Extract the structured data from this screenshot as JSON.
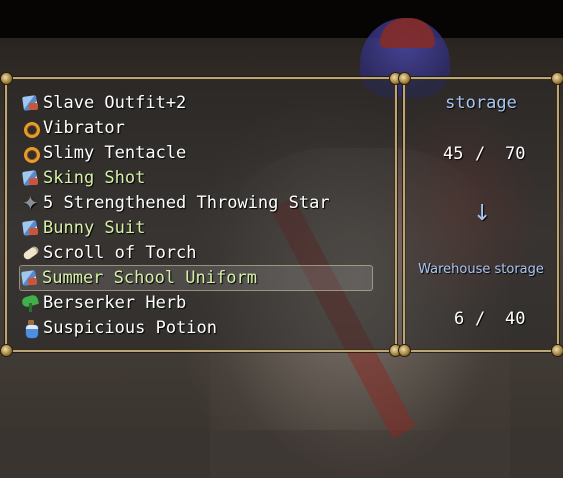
{
  "items": [
    {
      "icon": "outfit-icon",
      "label": "Slave Outfit+2",
      "color": "#ffffff"
    },
    {
      "icon": "ring-icon",
      "label": "Vibrator",
      "color": "#ffffff"
    },
    {
      "icon": "ring-icon",
      "label": "Slimy Tentacle",
      "color": "#ffffff"
    },
    {
      "icon": "outfit-icon",
      "label": "Sking Shot",
      "color": "#d6f0a8"
    },
    {
      "icon": "throwing-star-icon",
      "label": "5 Strengthened Throwing Star",
      "color": "#ffffff"
    },
    {
      "icon": "outfit-icon",
      "label": "Bunny Suit",
      "color": "#d6f0a8"
    },
    {
      "icon": "scroll-icon",
      "label": "Scroll of Torch",
      "color": "#ffffff"
    },
    {
      "icon": "outfit-icon",
      "label": "Summer School Uniform",
      "color": "#d6f0a8",
      "selected": true
    },
    {
      "icon": "herb-icon",
      "label": "Berserker Herb",
      "color": "#ffffff"
    },
    {
      "icon": "potion-icon",
      "label": "Suspicious Potion",
      "color": "#ffffff"
    }
  ],
  "storage": {
    "title": "storage",
    "current": "45",
    "separator": "/",
    "max": "70",
    "arrow": "↓",
    "warehouse_title": "Warehouse storage",
    "warehouse_current": "6",
    "warehouse_max": "40"
  },
  "colors": {
    "accent": "#a9c6f2",
    "frame": "#b9a67a",
    "highlight_text": "#d6f0a8"
  }
}
